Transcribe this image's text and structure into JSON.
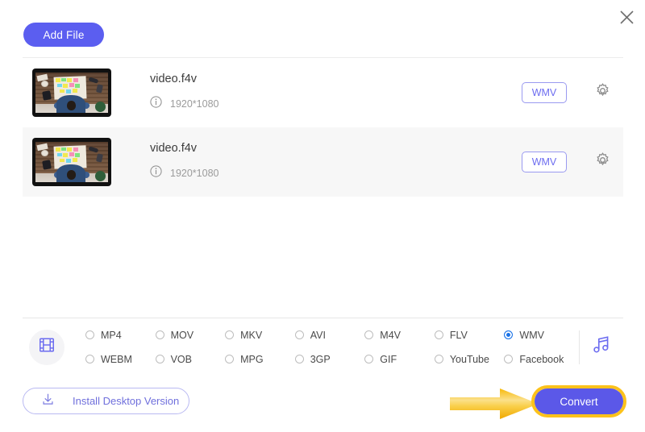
{
  "window": {
    "close_icon": "close-icon"
  },
  "toolbar": {
    "add_file_label": "Add File"
  },
  "file_list": {
    "rows": [
      {
        "name": "video.f4v",
        "resolution": "1920*1080",
        "format_badge": "WMV",
        "info_icon": "info-circle-icon",
        "settings_icon": "gear-icon",
        "thumbnail": "video-thumbnail-desk-sticky-notes"
      },
      {
        "name": "video.f4v",
        "resolution": "1920*1080",
        "format_badge": "WMV",
        "info_icon": "info-circle-icon",
        "settings_icon": "gear-icon",
        "thumbnail": "video-thumbnail-desk-sticky-notes"
      }
    ]
  },
  "format_bar": {
    "video_icon": "film-strip-icon",
    "audio_icon": "music-note-icon",
    "selected": "WMV",
    "options": [
      {
        "label": "MP4",
        "selected": false
      },
      {
        "label": "MOV",
        "selected": false
      },
      {
        "label": "MKV",
        "selected": false
      },
      {
        "label": "AVI",
        "selected": false
      },
      {
        "label": "M4V",
        "selected": false
      },
      {
        "label": "FLV",
        "selected": false
      },
      {
        "label": "WMV",
        "selected": true
      },
      {
        "label": "WEBM",
        "selected": false
      },
      {
        "label": "VOB",
        "selected": false
      },
      {
        "label": "MPG",
        "selected": false
      },
      {
        "label": "3GP",
        "selected": false
      },
      {
        "label": "GIF",
        "selected": false
      },
      {
        "label": "YouTube",
        "selected": false
      },
      {
        "label": "Facebook",
        "selected": false
      }
    ]
  },
  "footer": {
    "install_label": "Install Desktop Version",
    "install_icon": "download-icon",
    "convert_label": "Convert",
    "annotation_arrow": "arrow-right-highlight"
  },
  "colors": {
    "accent_purple": "#5b5ef0",
    "convert_purple": "#5b58e8",
    "highlight_yellow": "#fcc21b",
    "radio_selected_blue": "#1a73e8",
    "row_alt_background": "#f7f7f7",
    "badge_border": "#9a9af0"
  }
}
